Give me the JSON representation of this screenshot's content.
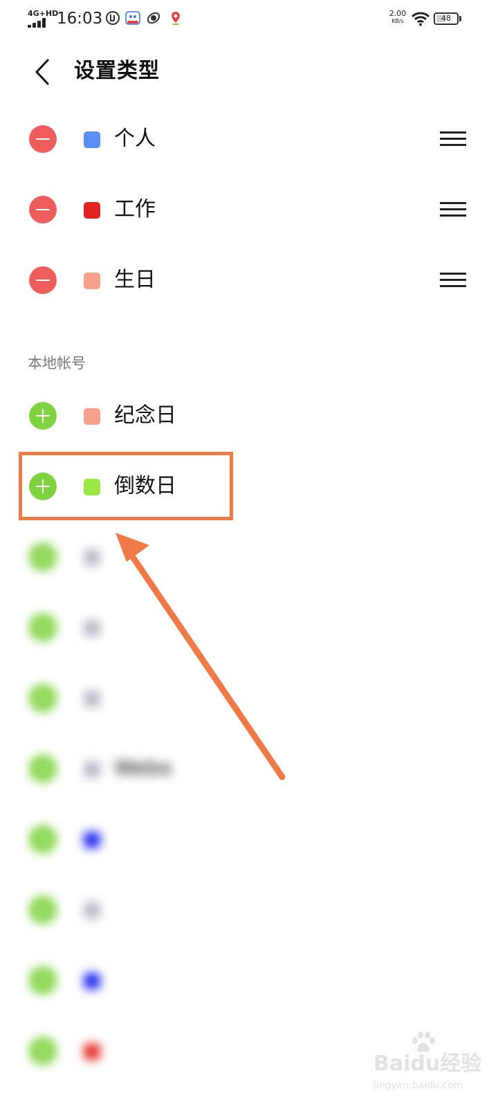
{
  "status_bar": {
    "network": "4G+HD",
    "time": "16:03",
    "speed_value": "2.00",
    "speed_unit": "KB/s",
    "battery": "48",
    "battery_level": 0.48
  },
  "header": {
    "title": "设置类型"
  },
  "types": [
    {
      "label": "个人",
      "color": "#5a8ef5"
    },
    {
      "label": "工作",
      "color": "#e32222"
    },
    {
      "label": "生日",
      "color": "#f7a08c"
    }
  ],
  "local_section": {
    "header": "本地帐号",
    "items": [
      {
        "label": "纪念日",
        "color": "#f7a08c"
      },
      {
        "label": "倒数日",
        "color": "#9be845"
      },
      {
        "label": "",
        "color": "#b8bcc8"
      },
      {
        "label": "",
        "color": "#b8bcc8"
      },
      {
        "label": "",
        "color": "#b8bcc8"
      },
      {
        "label": "Webo",
        "color": "#b8bcc8"
      },
      {
        "label": "",
        "color": "#2a2ef0"
      },
      {
        "label": "",
        "color": "#b8bcc8"
      },
      {
        "label": "",
        "color": "#2a2ef0"
      },
      {
        "label": "",
        "color": "#e83030"
      }
    ]
  },
  "watermark": {
    "brand": "Baidu经验",
    "url": "jingyan.baidu.com"
  },
  "colors": {
    "remove": "#ee5c5c",
    "add": "#7ed33f",
    "annotation": "#f07a46"
  }
}
